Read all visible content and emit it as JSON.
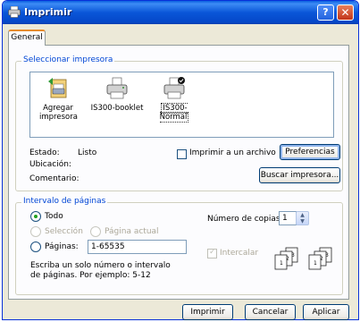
{
  "window": {
    "title": "Imprimir",
    "help_glyph": "?",
    "close_glyph": "✕"
  },
  "tabs": [
    {
      "label": "General"
    }
  ],
  "printer_group": {
    "title": "Seleccionar impresora",
    "printers": [
      {
        "label": "Agregar impresora",
        "icon": "add-printer-icon"
      },
      {
        "label": "IS300-booklet",
        "icon": "printer-icon"
      },
      {
        "label": "IS300-Normal",
        "icon": "default-printer-icon",
        "selected": true
      }
    ],
    "status_label": "Estado:",
    "status_value": "Listo",
    "location_label": "Ubicación:",
    "location_value": "",
    "comment_label": "Comentario:",
    "comment_value": "",
    "print_to_file_label": "Imprimir a un archivo",
    "preferences_button": "Preferencias",
    "find_printer_button": "Buscar impresora..."
  },
  "range_group": {
    "title": "Intervalo de páginas",
    "all_label": "Todo",
    "selection_label": "Selección",
    "current_page_label": "Página actual",
    "pages_label": "Páginas:",
    "pages_value": "1-65535",
    "hint": "Escriba un solo número o intervalo de páginas. Por ejemplo: 5-12"
  },
  "copies": {
    "label": "Número de copias:",
    "value": "1",
    "collate_label": "Intercalar",
    "collate_checked": true,
    "collate_enabled": false
  },
  "buttons": {
    "print": "Imprimir",
    "cancel": "Cancelar",
    "apply": "Aplicar"
  }
}
